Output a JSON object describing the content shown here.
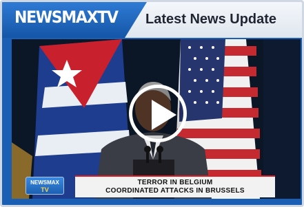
{
  "header": {
    "logo_text": "NEWSMAXTV",
    "title": "Latest News Update"
  },
  "video": {
    "play_icon": "play-icon",
    "ticker_logo_top": "NEWSMAX",
    "ticker_logo_bottom": "TV",
    "lower_third_line1": "TERROR IN BELGIUM",
    "lower_third_line2": "COORDINATED ATTACKS IN BRUSSELS"
  },
  "colors": {
    "brand_blue": "#1a5fb4",
    "accent_red": "#d61f26"
  }
}
